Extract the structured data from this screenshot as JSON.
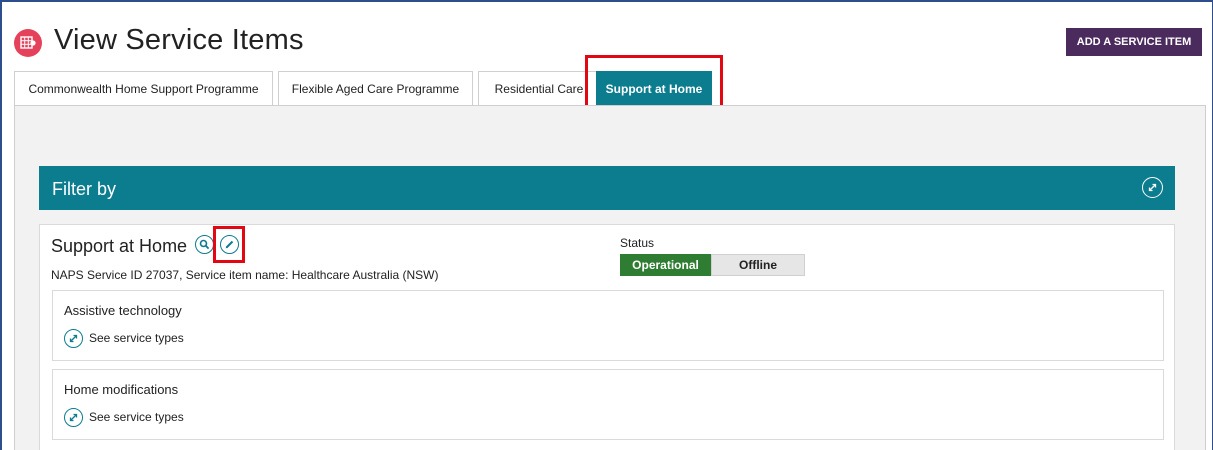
{
  "header": {
    "title": "View Service Items",
    "add_button": "ADD A SERVICE ITEM"
  },
  "tabs": [
    {
      "label": "Commonwealth Home Support Programme",
      "active": false
    },
    {
      "label": "Flexible Aged Care Programme",
      "active": false
    },
    {
      "label": "Residential Care",
      "active": false
    },
    {
      "label": "Support at Home",
      "active": true
    }
  ],
  "filter": {
    "title": "Filter by"
  },
  "service": {
    "name": "Support at Home",
    "details": "NAPS Service ID 27037, Service item name: Healthcare Australia (NSW)",
    "status": {
      "label": "Status",
      "options": [
        "Operational",
        "Offline"
      ],
      "selected": "Operational"
    },
    "sub_items": [
      {
        "title": "Assistive technology",
        "link": "See service types"
      },
      {
        "title": "Home modifications",
        "link": "See service types"
      }
    ]
  },
  "colors": {
    "accent": "#0c7c8f",
    "button_purple": "#4b2a5e",
    "status_green": "#2e7d32",
    "app_icon": "#e5415b",
    "highlight": "#e30613"
  },
  "icons": {
    "app": "grid-gear-icon",
    "expand": "expand-icon",
    "view": "magnify-icon",
    "edit": "pencil-icon"
  }
}
